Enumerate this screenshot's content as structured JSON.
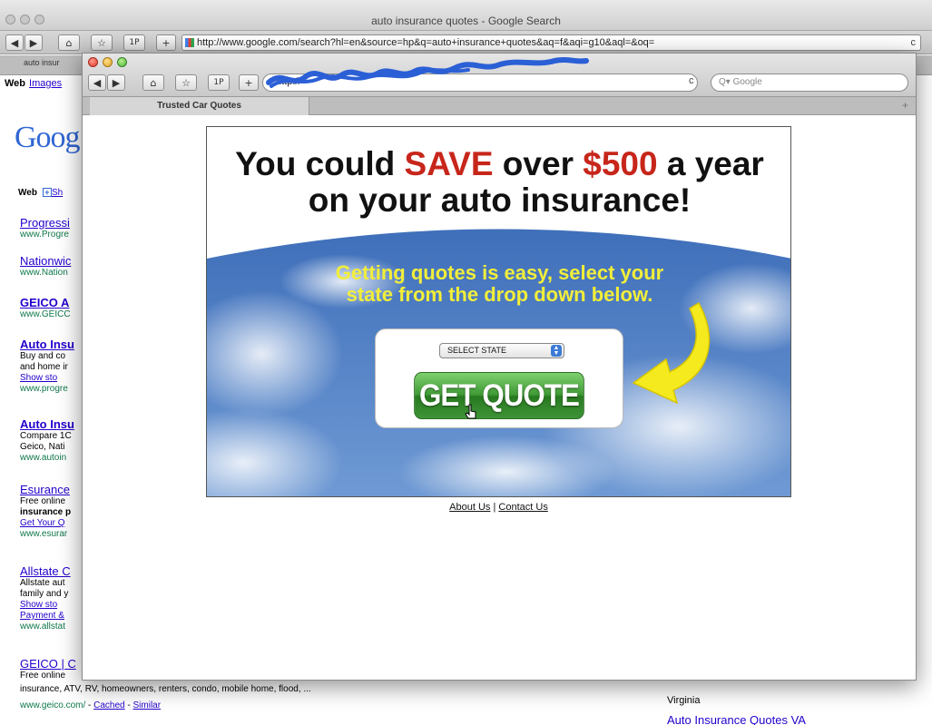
{
  "background_browser": {
    "title": "auto insurance quotes - Google Search",
    "url": "http://www.google.com/search?hl=en&source=hp&q=auto+insurance+quotes&aq=f&aqi=g10&aql=&oq=",
    "reload_icon": "reload-icon",
    "tab_label": "auto insur",
    "nav_web": "Web",
    "nav_images": "Images",
    "logo": "Goog",
    "web_label": "Web",
    "show_label": "Sh",
    "results": [
      {
        "title": "Progressi",
        "url": "www.Progre"
      },
      {
        "title": "Nationwic",
        "url": "www.Nation"
      },
      {
        "title": "GEICO A",
        "url": "www.GEICC"
      },
      {
        "title": "Auto Insu",
        "lines": [
          "Buy and co",
          "and home ir"
        ],
        "show": "Show sto",
        "url": "www.progre"
      },
      {
        "title": "Auto Insu",
        "lines": [
          "Compare 1C",
          "Geico, Nati"
        ],
        "url": "www.autoin"
      },
      {
        "title": "Esurance",
        "lines": [
          "Free online",
          "insurance p"
        ],
        "link": "Get Your Q",
        "url": "www.esurar"
      },
      {
        "title": "Allstate C",
        "lines": [
          "Allstate aut",
          "family and y"
        ],
        "show": "Show sto",
        "link": "Payment &",
        "url": "www.allstat"
      },
      {
        "title": "GEICO | C",
        "lines": [
          "Free online"
        ]
      }
    ],
    "bottom_snippet": "insurance, ATV, RV, homeowners, renters, condo, mobile home, flood, ...",
    "bottom_url": "www.geico.com/",
    "bottom_cached": "Cached",
    "bottom_similar": "Similar",
    "right_text": "Virginia",
    "right_link": "Auto Insurance Quotes VA"
  },
  "popup": {
    "url_text": "http://",
    "search_placeholder": "Google",
    "tab_label": "Trusted Car Quotes",
    "tab_add": "+",
    "ad": {
      "headline_line1_pre": "You could ",
      "headline_save": "SAVE",
      "headline_mid": " over ",
      "headline_amount": "$500",
      "headline_post": " a year",
      "headline_line2": "on your auto insurance!",
      "sub_line1": "Getting quotes is easy, select your",
      "sub_line2": "state from the drop down below.",
      "select_value": "SELECT STATE",
      "button_label": "GET QUOTE",
      "accent_red": "#c7261b",
      "sub_yellow": "#f2ee3a",
      "button_green": "#3f9a35"
    },
    "footer_about": "About Us",
    "footer_sep": "|",
    "footer_contact": "Contact Us"
  }
}
